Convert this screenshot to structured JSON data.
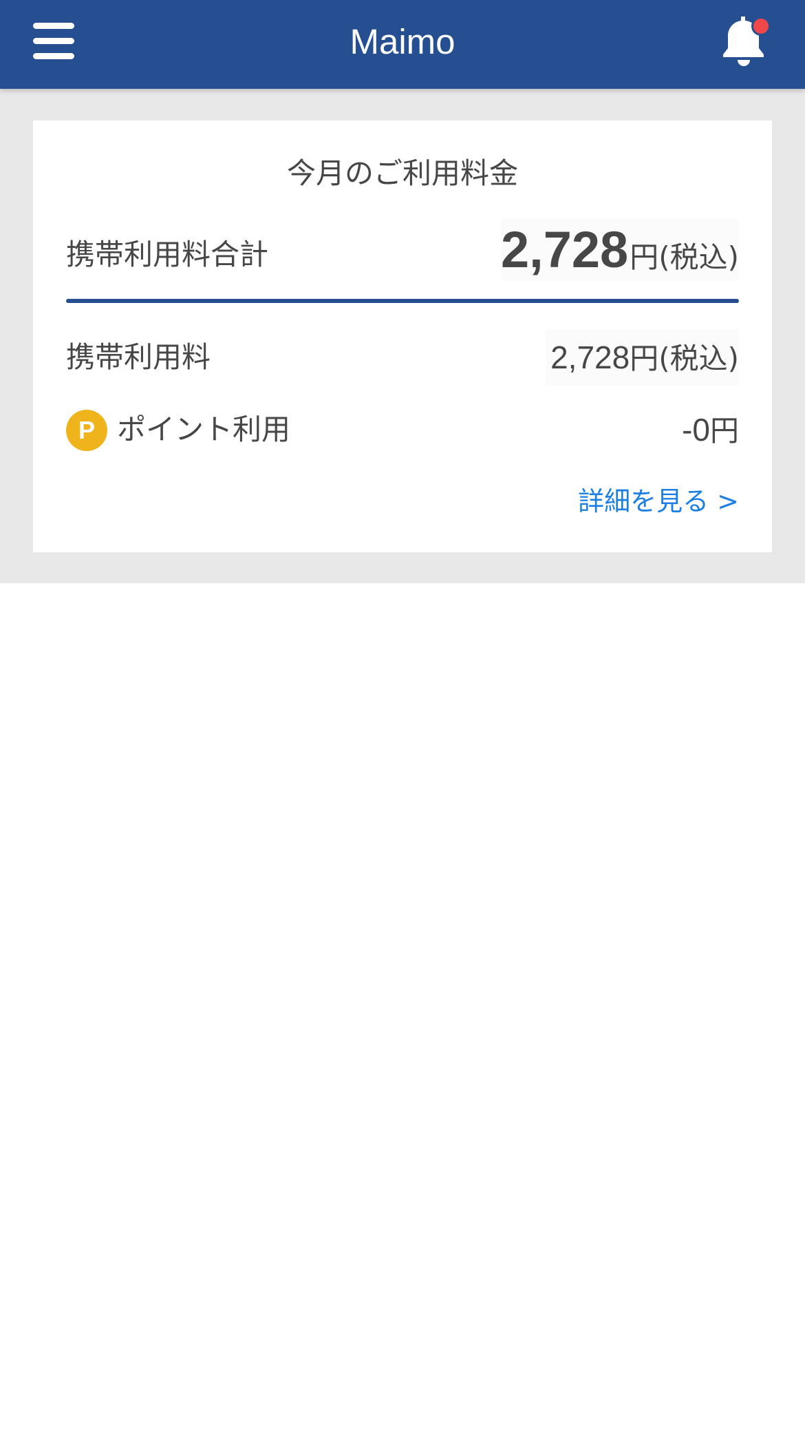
{
  "header": {
    "title": "Maimo",
    "menu_icon": "hamburger-menu-icon",
    "notification_icon": "bell-icon",
    "notification_badge_color": "#f04848",
    "background_color": "#264f92"
  },
  "billing": {
    "title": "今月のご利用料金",
    "total_label": "携帯利用料合計",
    "total_amount": "2,728",
    "total_yen": "円",
    "total_tax": "(税込)",
    "fee_label": "携帯利用料",
    "fee_amount": "2,728",
    "fee_suffix": "円(税込)",
    "point_icon_letter": "P",
    "point_label": "ポイント利用",
    "point_amount": "-0",
    "point_suffix": "円",
    "detail_link": "詳細を見る >"
  }
}
